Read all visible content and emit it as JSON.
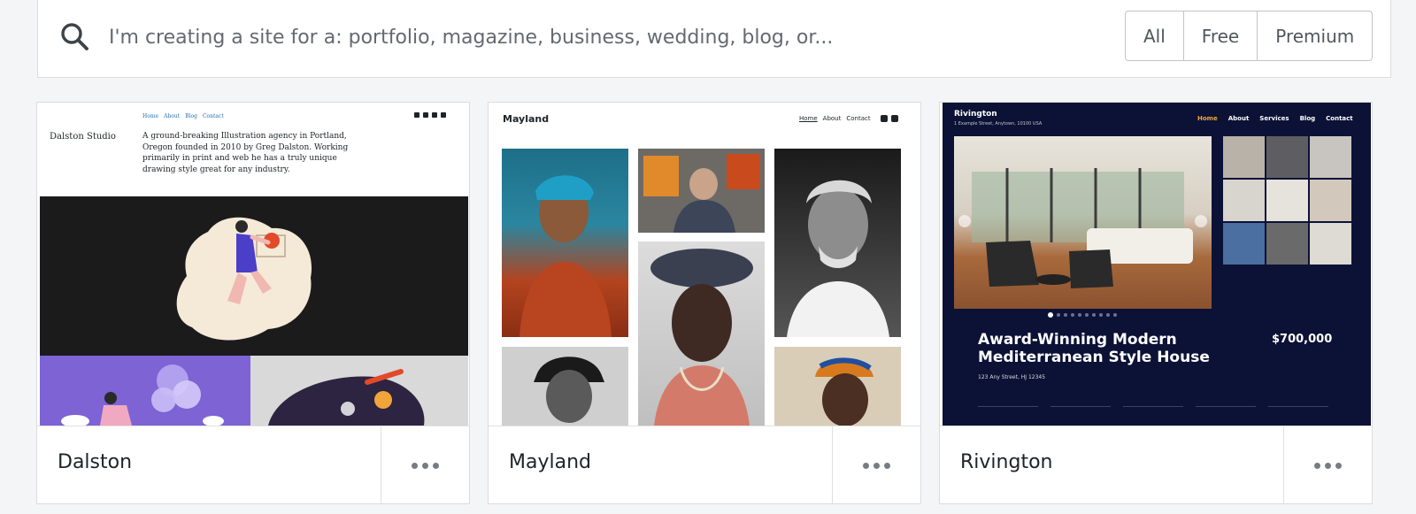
{
  "search": {
    "placeholder": "I'm creating a site for a: portfolio, magazine, business, wedding, blog, or..."
  },
  "filter": {
    "options": [
      "All",
      "Free",
      "Premium"
    ]
  },
  "cards": [
    {
      "name": "Dalston",
      "preview": {
        "brand": "Dalston Studio",
        "nav": [
          "Home",
          "About",
          "Blog",
          "Contact"
        ],
        "intro": "A ground-breaking Illustration agency in Portland, Oregon founded in 2010 by Greg Dalston. Working primarily in print and web he has a truly unique drawing style great for any industry."
      }
    },
    {
      "name": "Mayland",
      "preview": {
        "brand": "Mayland",
        "nav": [
          "Home",
          "About",
          "Contact"
        ]
      }
    },
    {
      "name": "Rivington",
      "preview": {
        "brand": "Rivington",
        "address": "1 Example Street, Anytown, 10100 USA",
        "nav": [
          "Home",
          "About",
          "Services",
          "Blog",
          "Contact"
        ],
        "headline": "Award-Winning Modern Mediterranean Style House",
        "price": "$700,000",
        "street": "123 Any Street, HJ 12345"
      }
    }
  ],
  "colors": {
    "page_background": "#f4f5f6",
    "rivington_navy": "#0c1236",
    "rivington_accent": "#f0a53a",
    "dalston_link": "#2271b1",
    "dalston_purple": "#7d63d4"
  },
  "icons": [
    "search-icon",
    "more-icon",
    "instagram-icon",
    "twitter-icon",
    "facebook-icon",
    "youtube-icon"
  ]
}
